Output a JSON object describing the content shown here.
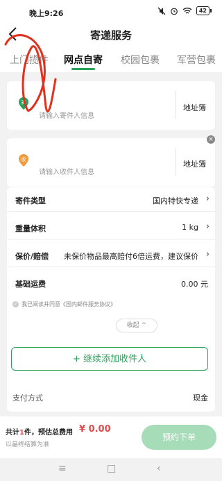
{
  "status": {
    "time": "晚上9:26",
    "battery": "42"
  },
  "header": {
    "title": "寄递服务"
  },
  "tabs": [
    {
      "label": "上门揽件"
    },
    {
      "label": "网点自寄"
    },
    {
      "label": "校园包裹"
    },
    {
      "label": "军营包裹"
    }
  ],
  "sender": {
    "icon": "寄",
    "placeholder": "请输入寄件人信息",
    "book": "地址簿"
  },
  "receiver": {
    "icon": "收",
    "placeholder": "请输入收件人信息",
    "book": "地址簿"
  },
  "form": {
    "rows": [
      {
        "key": "寄件类型",
        "value": "国内特快专递"
      },
      {
        "key": "重量体积",
        "value": "1 kg"
      },
      {
        "key": "保价/赔偿",
        "value": "未保价物品最高赔付6倍运费，建议保价"
      },
      {
        "key": "基础运费",
        "value": "0.00 元"
      }
    ],
    "agreement": "我已阅读并同意《国内邮件服务协议》",
    "collapse": "收起 ^",
    "add_receiver": "+ 继续添加收件人"
  },
  "payment": {
    "label": "支付方式",
    "value": "现金"
  },
  "footer": {
    "total_prefix": "共计",
    "total_count": "1",
    "total_suffix": "件，预估总费用",
    "price": "¥ 0.00",
    "note": "以最终结算为准",
    "submit": "预约下单"
  },
  "colors": {
    "accent": "#2aa35a",
    "price": "#e24b4b",
    "sender_icon": "#2aa35a",
    "receiver_icon": "#f29a3a",
    "annotation": "#e0301e"
  }
}
